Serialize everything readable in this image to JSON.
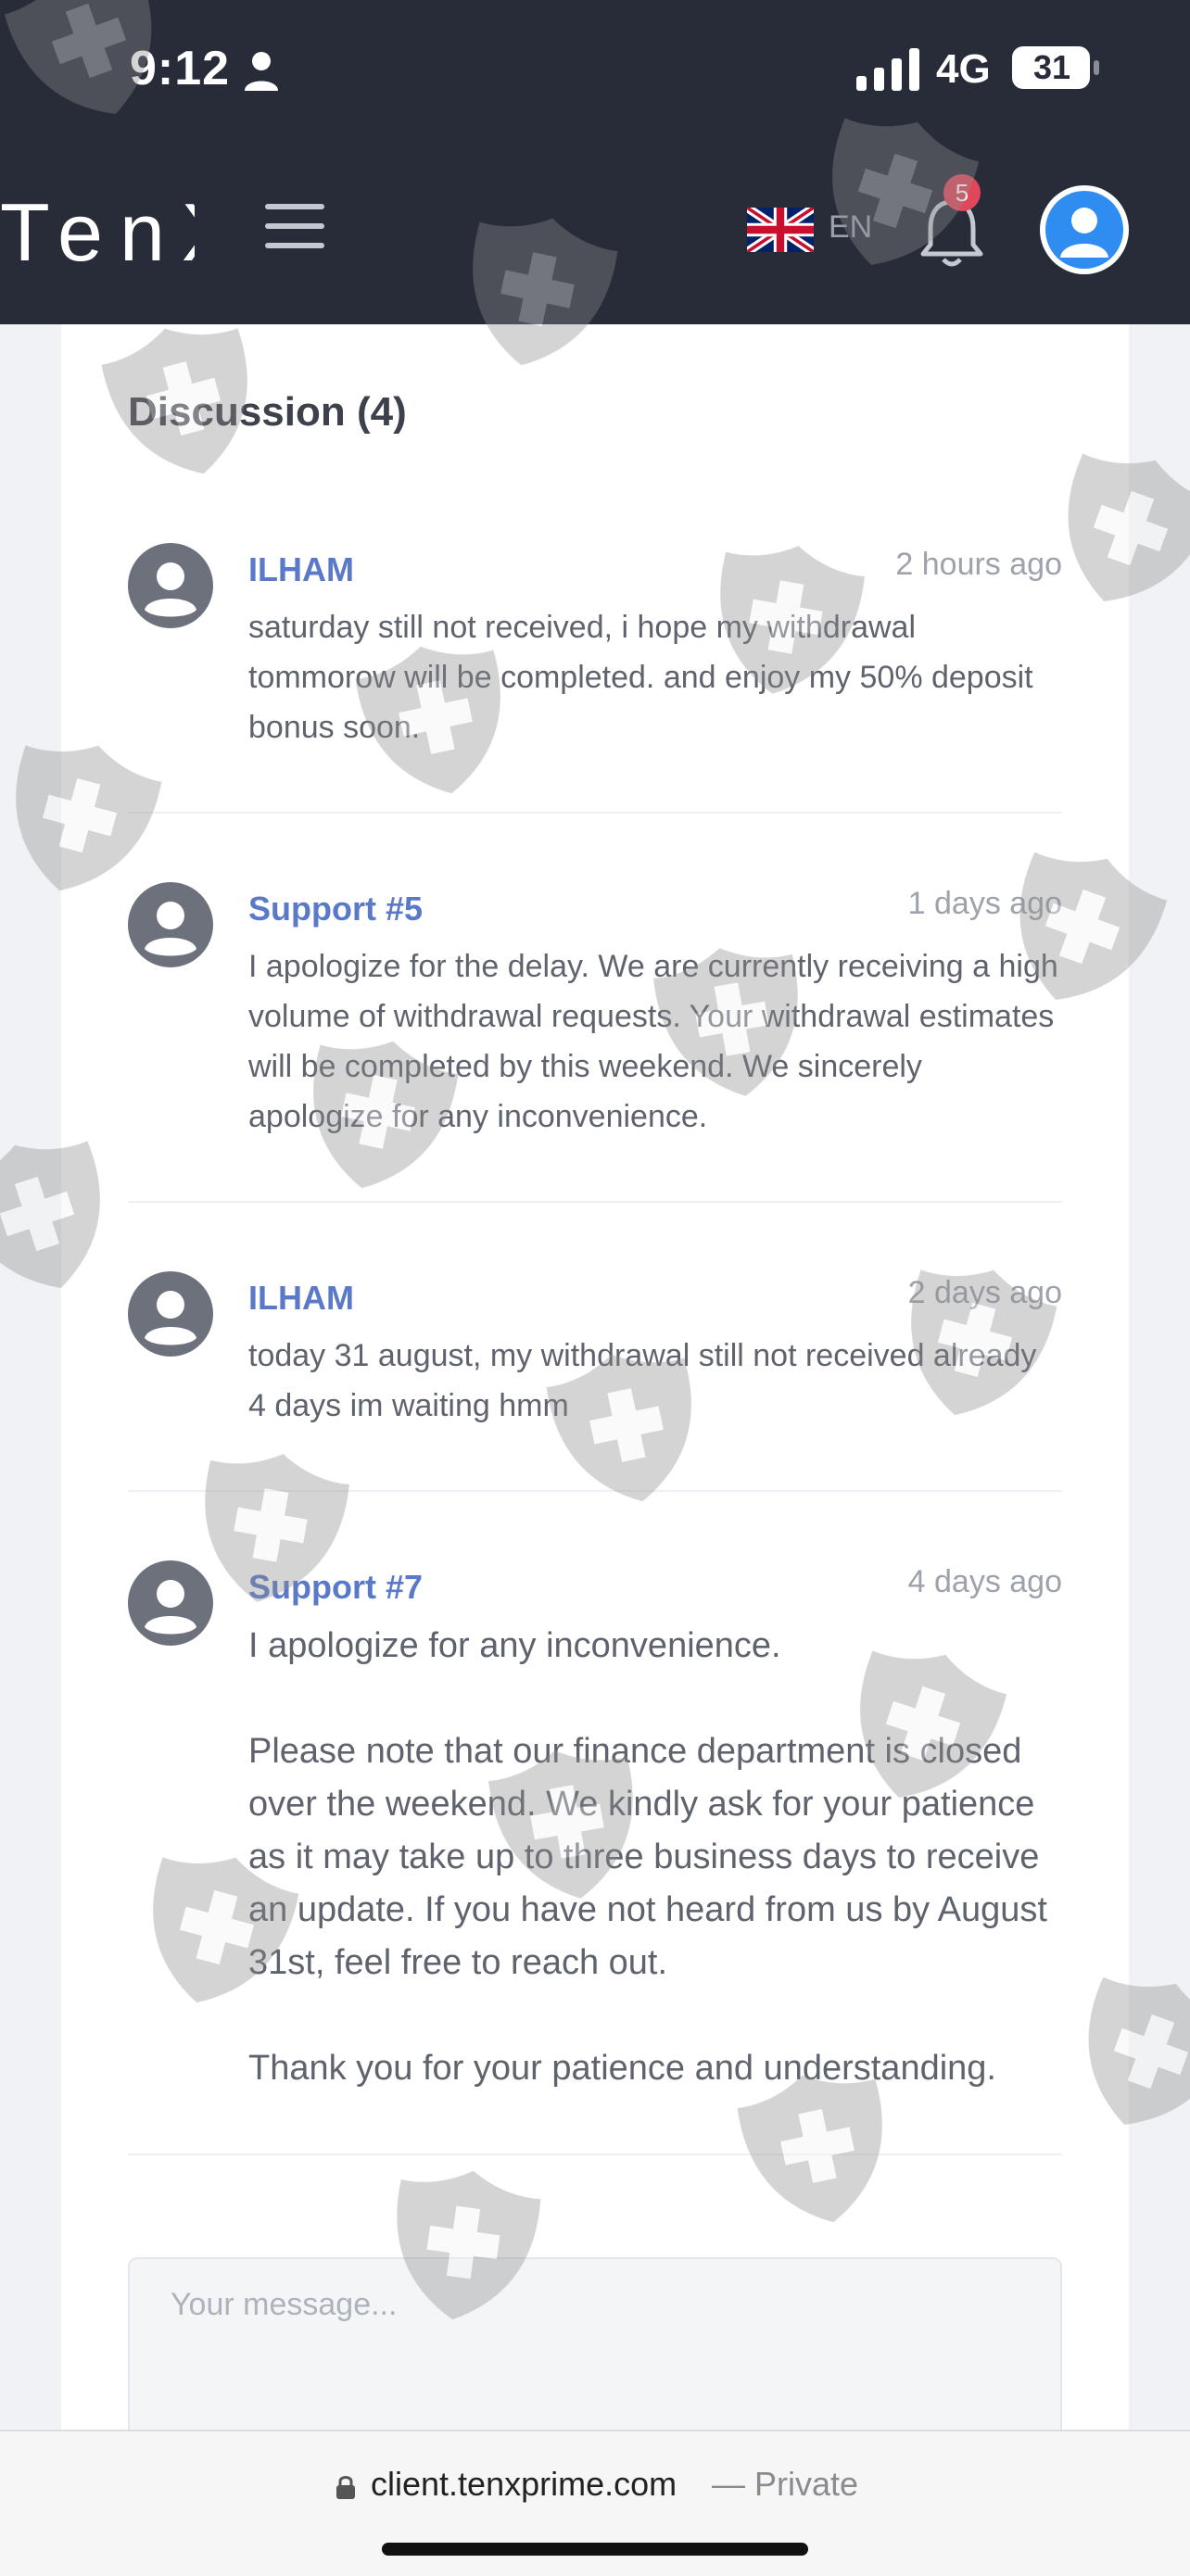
{
  "status_bar": {
    "time": "9:12",
    "network": "4G",
    "battery": "31"
  },
  "header": {
    "brand": "TenX",
    "language": "EN",
    "notification_count": "5"
  },
  "discussion": {
    "title": "Discussion (4)",
    "comments": [
      {
        "author": "ILHAM",
        "time": "2 hours ago",
        "body": "saturday still not received, i hope my withdrawal tommorow will be completed. and enjoy my 50% deposit bonus soon."
      },
      {
        "author": "Support #5",
        "time": "1 days ago",
        "body": "I apologize for the delay. We are currently receiving a high volume of withdrawal requests. Your withdrawal estimates will be completed by this weekend. We sincerely apologize for any inconvenience."
      },
      {
        "author": "ILHAM",
        "time": "2 days ago",
        "body": "today 31 august, my withdrawal still not received already 4 days im waiting hmm"
      },
      {
        "author": "Support #7",
        "time": "4 days ago",
        "body": "I apologize for any inconvenience.\n\nPlease note that our finance department is closed over the weekend. We kindly ask for your patience as it may take up to three business days to receive an update. If you have not heard from us by August 31st, feel free to reach out.\n\nThank you for your patience and understanding."
      }
    ]
  },
  "message": {
    "placeholder": "Your message..."
  },
  "browser": {
    "url": "client.tenxprime.com",
    "mode": "— Private"
  },
  "icons": {
    "person": "person-icon",
    "signal": "cellular-signal-icon",
    "battery": "battery-icon",
    "menu": "hamburger-menu-icon",
    "flag": "uk-flag-icon",
    "bell": "bell-icon",
    "profile": "user-avatar-icon",
    "comment_avatar": "default-user-avatar-icon",
    "lock": "lock-icon",
    "watermark": "shield-cross-watermark"
  },
  "colors": {
    "header_bg": "#272c38",
    "author": "#5b79c9",
    "badge": "#e0475b",
    "avatar_blue": "#2f8df2"
  }
}
